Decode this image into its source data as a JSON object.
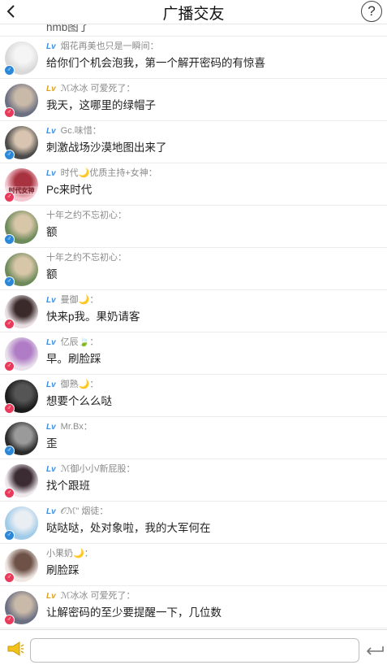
{
  "header": {
    "title": "广播交友",
    "help_label": "?"
  },
  "partial_message": "hmb图了",
  "messages": [
    {
      "level": "Lv",
      "name": "烟花再美也只是一瞬间：",
      "text": "给你们个机会泡我，第一个解开密码的有惊喜",
      "gender": "male",
      "avatar_color": "#d9d9d9",
      "avatar_accent": "#f5f5f5"
    },
    {
      "level": "Lv",
      "level_style": "gold",
      "name": "ℳ冰冰 可爱死了：",
      "text": "我天，这哪里的绿帽子",
      "gender": "female",
      "avatar_color": "#6b6f82",
      "avatar_accent": "#c9b9a8"
    },
    {
      "level": "Lv",
      "name": "Gc.味惜：",
      "text": "刺激战场沙漠地图出来了",
      "gender": "male",
      "avatar_color": "#4a4a4a",
      "avatar_accent": "#d8c4b0"
    },
    {
      "level": "Lv",
      "name": "时代🌙优质主持+女神：",
      "text": "Pc来时代",
      "gender": "female",
      "avatar_color": "#f4c6cf",
      "avatar_accent": "#a8323f",
      "avatar_text": "时代女神"
    },
    {
      "level": "",
      "name": "十年之约不忘初心：",
      "text": "额",
      "gender": "male",
      "avatar_color": "#6d8a5a",
      "avatar_accent": "#d7c6a8"
    },
    {
      "level": "",
      "name": "十年之约不忘初心：",
      "text": "额",
      "gender": "male",
      "avatar_color": "#6d8a5a",
      "avatar_accent": "#d7c6a8"
    },
    {
      "level": "Lv",
      "name": "曼御🌙：",
      "text": "快来p我。果奶请客",
      "gender": "female",
      "avatar_color": "#e9dfe3",
      "avatar_accent": "#3a2a2a"
    },
    {
      "level": "Lv",
      "name": "亿辰🍃：",
      "text": "早。刷脸踩",
      "gender": "female",
      "avatar_color": "#e8e0ea",
      "avatar_accent": "#b07cc6"
    },
    {
      "level": "Lv",
      "name": "御熟🌙：",
      "text": "想要个么么哒",
      "gender": "female",
      "avatar_color": "#1b1b1b",
      "avatar_accent": "#555555"
    },
    {
      "level": "Lv",
      "name": "Mr.Bx：",
      "text": "歪",
      "gender": "male",
      "avatar_color": "#2a2a2a",
      "avatar_accent": "#9a9a9a"
    },
    {
      "level": "Lv",
      "name": "ℳ御小小/新屁股：",
      "text": "找个跟班",
      "gender": "female",
      "avatar_color": "#efe9ee",
      "avatar_accent": "#3b2b33"
    },
    {
      "level": "Lv",
      "name": "𝒪ℳ\" 烟徒：",
      "text": "哒哒哒，处对象啦，我的大军何在",
      "gender": "male",
      "avatar_color": "#9fcbe8",
      "avatar_accent": "#e9eef3"
    },
    {
      "level": "",
      "name": "小果奶🌙：",
      "text": "刷脸踩",
      "gender": "female",
      "avatar_color": "#efe6e2",
      "avatar_accent": "#6e5248"
    },
    {
      "level": "Lv",
      "level_style": "gold",
      "name": "ℳ冰冰 可爱死了：",
      "text": "让解密码的至少要提醒一下，几位数",
      "gender": "female",
      "avatar_color": "#6b6f82",
      "avatar_accent": "#c9b9a8"
    }
  ],
  "footer": {
    "input_value": "",
    "input_placeholder": ""
  }
}
